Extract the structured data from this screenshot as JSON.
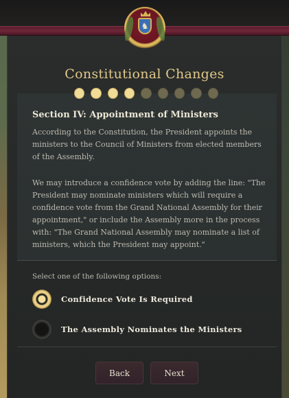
{
  "dialog": {
    "title": "Constitutional Changes",
    "progress": {
      "total_steps": 9,
      "completed_steps": 4
    },
    "section_title": "Section IV: Appointment of Ministers",
    "paragraphs": [
      "According to the Constitution, the President appoints the ministers to the Council of Ministers from elected members of the Assembly.",
      "We may introduce a confidence vote by adding the line: \"The President may nominate ministers which will require a confidence vote from the Grand National Assembly for their appointment,\" or include the Assembly more in the process with: \"The Grand National Assembly may nominate a list of ministers, which the President may appoint.\""
    ],
    "options_prompt": "Select one of the following options:",
    "options": [
      {
        "label": "Confidence Vote Is Required",
        "selected": true
      },
      {
        "label": "The Assembly Nominates the Ministers",
        "selected": false
      }
    ],
    "buttons": {
      "back": "Back",
      "next": "Next"
    }
  },
  "colors": {
    "title_gold": "#e2c98a",
    "ribbon": "#6e2638",
    "dot_done": "#f0db97",
    "dot_todo": "#6f6a4f",
    "button_bg": "#3b2a2e"
  },
  "icons": {
    "emblem": "coat-of-arms-emblem"
  }
}
